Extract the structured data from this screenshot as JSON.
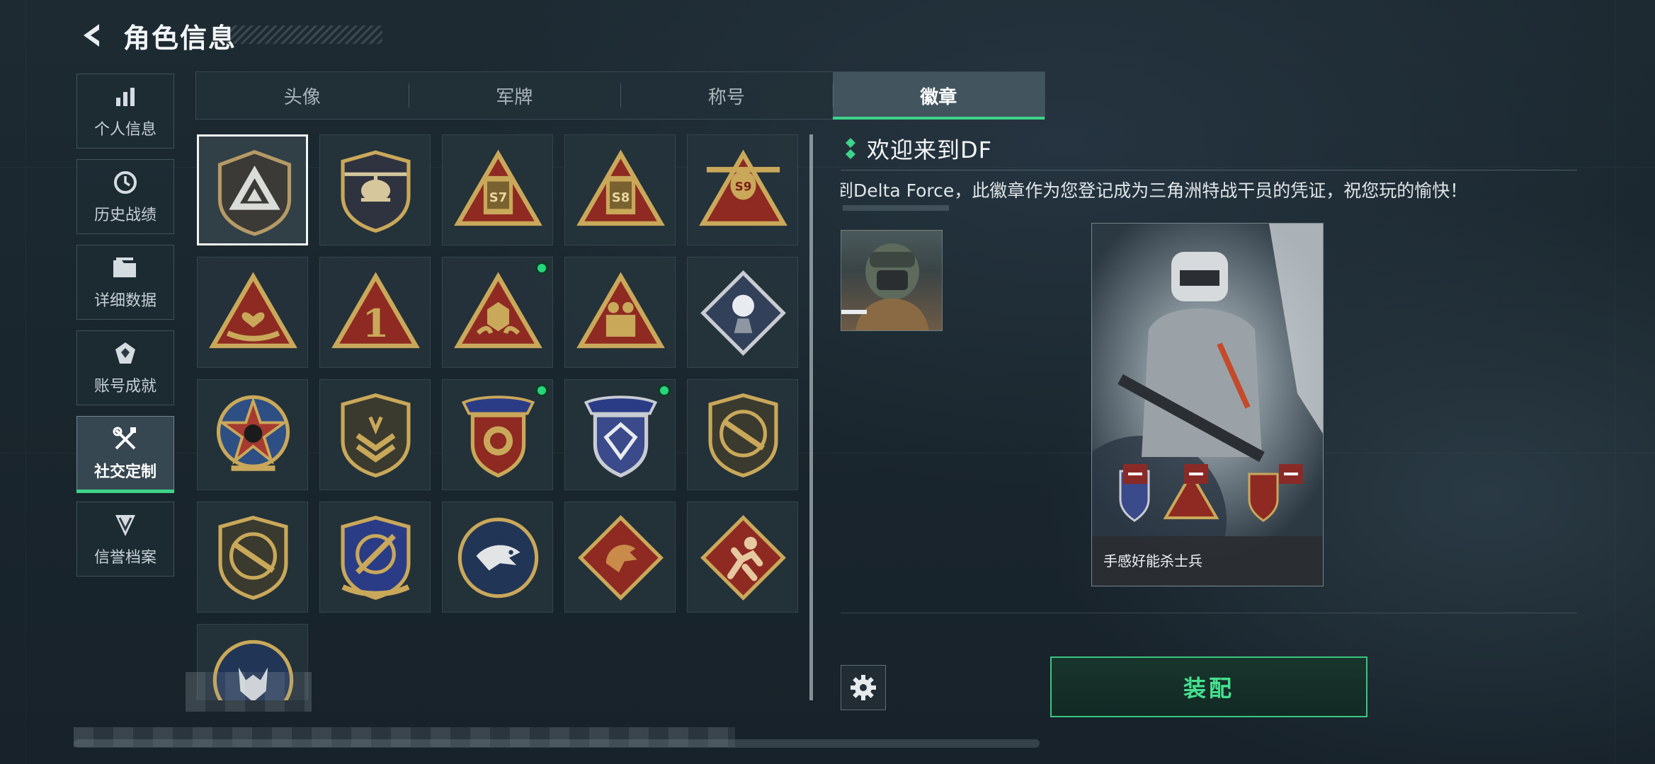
{
  "header": {
    "title": "角色信息"
  },
  "sidebar": {
    "items": [
      {
        "label": "个人信息",
        "icon": "bar-chart-icon"
      },
      {
        "label": "历史战绩",
        "icon": "clock-history-icon"
      },
      {
        "label": "详细数据",
        "icon": "folder-icon"
      },
      {
        "label": "账号成就",
        "icon": "achievement-icon"
      },
      {
        "label": "社交定制",
        "icon": "tools-icon",
        "active": true
      },
      {
        "label": "信誉档案",
        "icon": "credit-shield-icon"
      }
    ]
  },
  "tabs": [
    {
      "label": "头像"
    },
    {
      "label": "军牌"
    },
    {
      "label": "称号"
    },
    {
      "label": "徽章",
      "active": true
    }
  ],
  "badges": {
    "items": [
      {
        "label": "S7"
      },
      {
        "label": "S8"
      },
      {
        "label": "S9"
      },
      {
        "label": "1"
      }
    ],
    "scroll_fraction": 1.0
  },
  "detail": {
    "title": "欢迎来到DF",
    "description": "来到Delta Force，此徽章作为您登记成为三角洲特战干员的凭证，祝您玩的愉快！"
  },
  "card": {
    "name": "手感好能杀士兵"
  },
  "actions": {
    "equip_label": "装配"
  },
  "colors": {
    "accent": "#3ed48a",
    "new_dot": "#25d67a",
    "badge_gold": "#c9a85a",
    "badge_red": "#8e2a22"
  }
}
